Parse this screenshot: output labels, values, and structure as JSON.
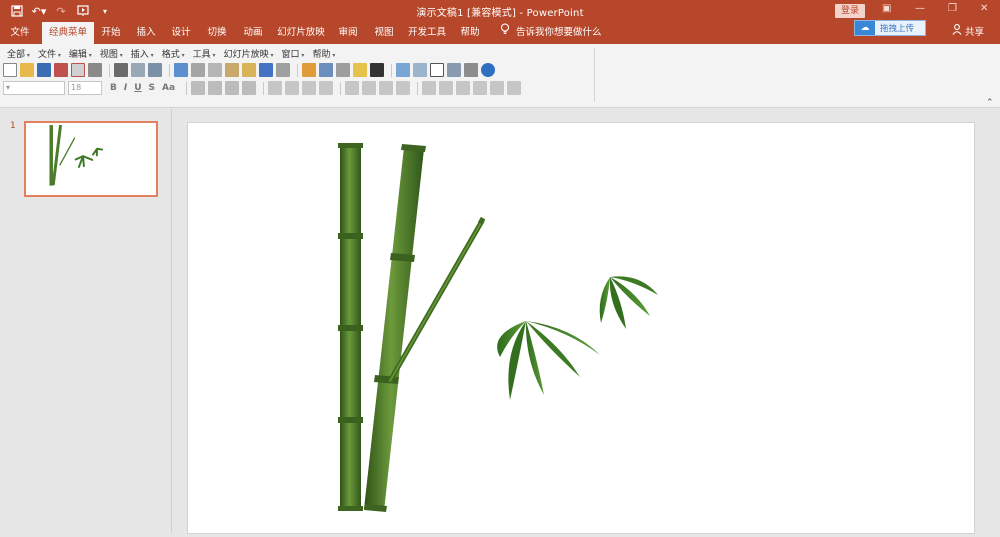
{
  "window": {
    "title": "演示文稿1 [兼容模式] - PowerPoint",
    "login_label": "登录"
  },
  "tabs": [
    {
      "label": "文件"
    },
    {
      "label": "经典菜单"
    },
    {
      "label": "开始"
    },
    {
      "label": "插入"
    },
    {
      "label": "设计"
    },
    {
      "label": "切换"
    },
    {
      "label": "动画"
    },
    {
      "label": "幻灯片放映"
    },
    {
      "label": "审阅"
    },
    {
      "label": "视图"
    },
    {
      "label": "开发工具"
    },
    {
      "label": "帮助"
    }
  ],
  "active_tab": "经典菜单",
  "tell_me": "告诉我你想要做什么",
  "upload_label": "拖拽上传",
  "share_label": "共享",
  "classic_menu": [
    {
      "label": "全部"
    },
    {
      "label": "文件"
    },
    {
      "label": "编辑"
    },
    {
      "label": "视图"
    },
    {
      "label": "插入"
    },
    {
      "label": "格式"
    },
    {
      "label": "工具"
    },
    {
      "label": "幻灯片放映"
    },
    {
      "label": "窗口"
    },
    {
      "label": "帮助"
    }
  ],
  "font_size_value": "18",
  "slide_panel": {
    "slide_number": "1"
  },
  "colors": {
    "accent": "#b7472a",
    "bamboo": "#4e7b2a",
    "leaf": "#3f7a26"
  }
}
